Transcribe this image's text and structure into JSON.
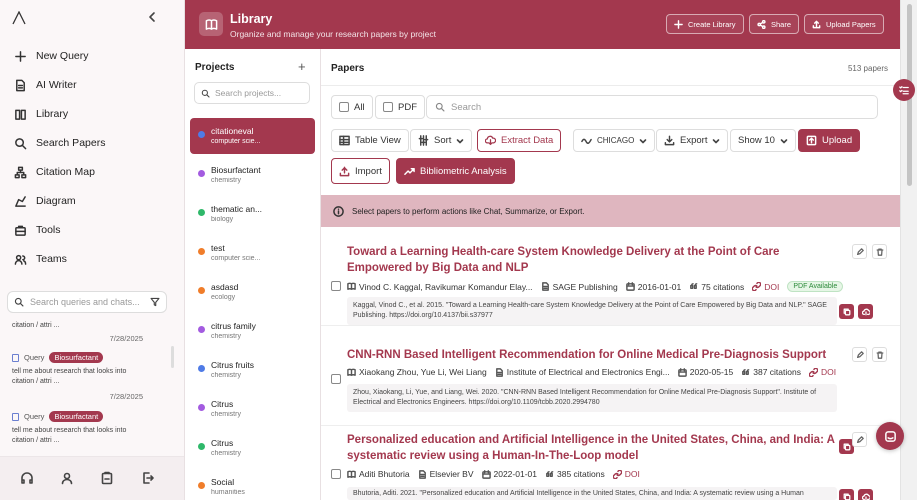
{
  "sidebar": {
    "nav": [
      {
        "label": "New Query",
        "icon": "plus-icon"
      },
      {
        "label": "AI Writer",
        "icon": "document-icon"
      },
      {
        "label": "Library",
        "icon": "library-icon"
      },
      {
        "label": "Search Papers",
        "icon": "search-icon"
      },
      {
        "label": "Citation Map",
        "icon": "network-icon"
      },
      {
        "label": "Diagram",
        "icon": "diagram-icon"
      },
      {
        "label": "Tools",
        "icon": "tools-icon"
      },
      {
        "label": "Teams",
        "icon": "users-icon"
      }
    ],
    "history_search_placeholder": "Search queries and chats...",
    "history": {
      "top_text": "citation / attri ...",
      "top_date": "7/28/2025",
      "items": [
        {
          "type": "Query",
          "tag": "Biosurfactant",
          "text": "tell me about research that looks into citation / attri ...",
          "date": "7/28/2025"
        },
        {
          "type": "Query",
          "tag": "Biosurfactant",
          "text": "tell me about research that looks into citation / attri ...",
          "date": ""
        }
      ]
    },
    "footer_icons": [
      "headphones-icon",
      "user-icon",
      "clipboard-icon",
      "logout-icon"
    ]
  },
  "header": {
    "title": "Library",
    "subtitle": "Organize and manage your research papers by project",
    "buttons": [
      "Create Library",
      "Share",
      "Upload Papers"
    ]
  },
  "projects": {
    "title": "Projects",
    "search_placeholder": "Search projects...",
    "items": [
      {
        "name": "citationeval",
        "category": "computer scie...",
        "color": "#4f7be6",
        "active": true
      },
      {
        "name": "Biosurfactant",
        "category": "chemistry",
        "color": "#a35be0"
      },
      {
        "name": "thematic an...",
        "category": "biology",
        "color": "#2fb86a"
      },
      {
        "name": "test",
        "category": "computer scie...",
        "color": "#f07d2a"
      },
      {
        "name": "asdasd",
        "category": "ecology",
        "color": "#f07d2a"
      },
      {
        "name": "citrus family",
        "category": "chemistry",
        "color": "#a35be0"
      },
      {
        "name": "Citrus fruits",
        "category": "chemistry",
        "color": "#4f7be6"
      },
      {
        "name": "Citrus",
        "category": "chemistry",
        "color": "#a35be0"
      },
      {
        "name": "Citrus",
        "category": "chemistry",
        "color": "#2fb86a"
      },
      {
        "name": "Social",
        "category": "humanities",
        "color": "#f07d2a"
      }
    ]
  },
  "papers": {
    "title": "Papers",
    "count": "513 papers",
    "filters": {
      "all": "All",
      "pdf": "PDF",
      "search_placeholder": "Search"
    },
    "toolbar": {
      "table_view": "Table View",
      "sort": "Sort",
      "extract": "Extract Data",
      "style": "CHICAGO",
      "export": "Export",
      "show": "Show 10",
      "upload": "Upload",
      "import": "Import",
      "bibliometric": "Bibliometric Analysis"
    },
    "info": "Select papers to perform actions like Chat, Summarize, or Export.",
    "items": [
      {
        "title": "Toward a Learning Health-care System Knowledge Delivery at the Point of Care Empowered by Big Data and NLP",
        "authors": "Vinod C. Kaggal, Ravikumar Komandur Elay...",
        "publisher": "SAGE Publishing",
        "date": "2016-01-01",
        "citations": "75 citations",
        "doi": "DOI",
        "badge": "PDF Available",
        "citation": "Kaggal, Vinod C., et al. 2015. \"Toward a Learning Health-care System Knowledge Delivery at the Point of Care Empowered by Big Data and NLP.\" SAGE Publishing. https://doi.org/10.4137/bii.s37977"
      },
      {
        "title": "CNN-RNN Based Intelligent Recommendation for Online Medical Pre-Diagnosis Support",
        "authors": "Xiaokang Zhou, Yue Li, Wei Liang",
        "publisher": "Institute of Electrical and Electronics Engi...",
        "date": "2020-05-15",
        "citations": "387 citations",
        "doi": "DOI",
        "badge": "",
        "citation": "Zhou, Xiaokang, Li, Yue, and Liang, Wei. 2020. \"CNN-RNN Based Intelligent Recommendation for Online Medical Pre-Diagnosis Support\". Institute of Electrical and Electronics Engineers. https://doi.org/10.1109/tcbb.2020.2994780"
      },
      {
        "title": "Personalized education and Artificial Intelligence in the United States, China, and India: A systematic review using a Human-In-The-Loop model",
        "authors": "Aditi Bhutoria",
        "publisher": "Elsevier BV",
        "date": "2022-01-01",
        "citations": "385 citations",
        "doi": "DOI",
        "badge": "",
        "citation": "Bhutoria, Aditi. 2021. \"Personalized education and Artificial Intelligence in the United States, China, and India: A systematic review using a Human"
      }
    ]
  },
  "colors": {
    "accent": "#a3384e",
    "info_bg": "#dfb6bf"
  }
}
